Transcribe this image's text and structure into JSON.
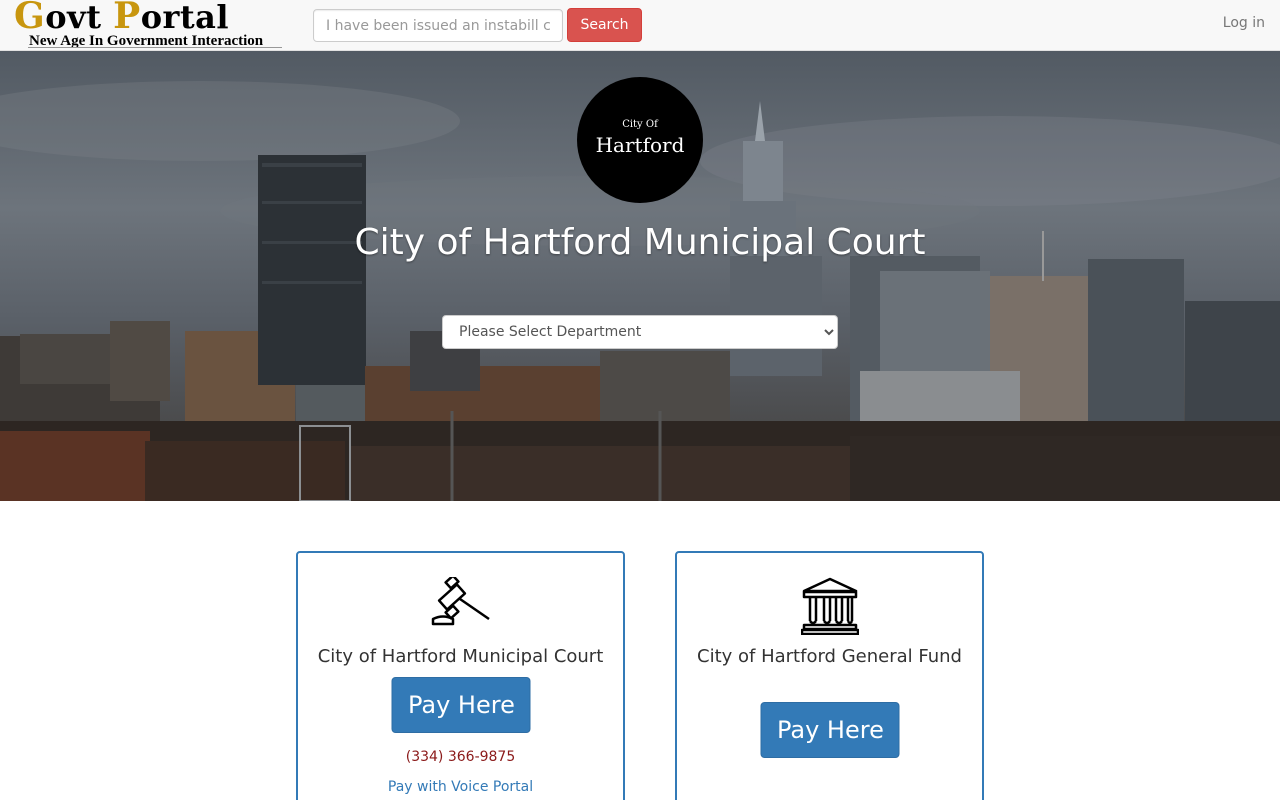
{
  "navbar": {
    "brand_g": "G",
    "brand_ovt": "ovt ",
    "brand_p": "P",
    "brand_ortal": "ortal",
    "tagline": "New Age In Government Interaction",
    "search_placeholder": "I have been issued an instabill c",
    "search_label": "Search",
    "login_label": "Log in"
  },
  "hero": {
    "seal_small": "City Of",
    "seal_big": "Hartford",
    "title": "City of Hartford Municipal Court",
    "select_value": "Please Select Department",
    "select_options": [
      "Please Select Department"
    ]
  },
  "cards": [
    {
      "icon": "gavel-icon",
      "title": "City of Hartford Municipal Court",
      "pay_label": "Pay Here",
      "phone": "(334) 366-9875",
      "voice_link": "Pay with Voice Portal"
    },
    {
      "icon": "courthouse-icon",
      "title": "City of Hartford General Fund",
      "pay_label": "Pay Here"
    }
  ],
  "colors": {
    "brand_gold": "#c8960f",
    "search_button": "#d9534f",
    "primary": "#337ab7",
    "phone_text": "#8b1a1a"
  }
}
